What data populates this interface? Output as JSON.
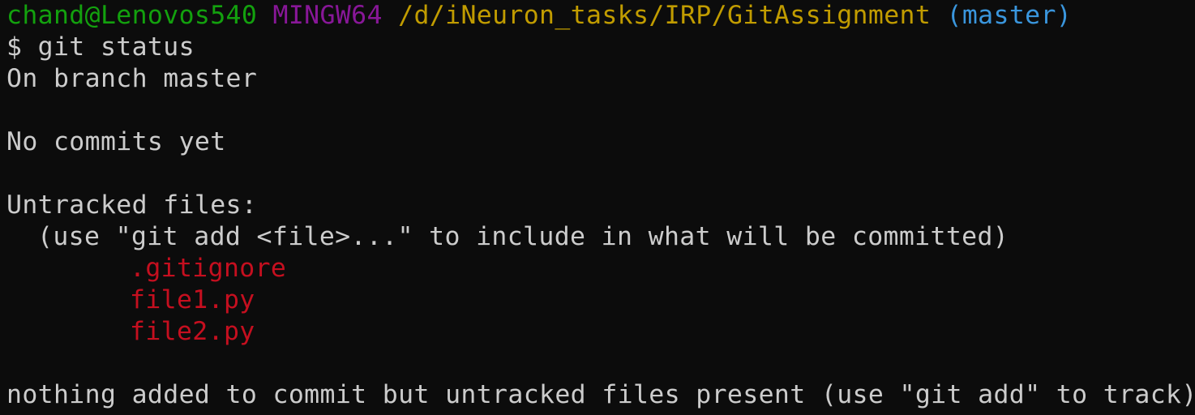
{
  "colors": {
    "background": "#0c0c0c",
    "foreground": "#cccccc",
    "user_host": "#13a10e",
    "msystem": "#881798",
    "path": "#c19c00",
    "branch": "#3a96dd",
    "untracked": "#c50f1f"
  },
  "prompt": {
    "user_host": "chand@Lenovos540",
    "msystem": "MINGW64",
    "path": "/d/iNeuron_tasks/IRP/GitAssignment",
    "branch": "(master)"
  },
  "command_line": "$ git status",
  "output": {
    "branch_line": "On branch master",
    "commits_line": "No commits yet",
    "untracked_header": "Untracked files:",
    "untracked_hint": "(use \"git add <file>...\" to include in what will be committed)",
    "untracked_files": [
      ".gitignore",
      "file1.py",
      "file2.py"
    ],
    "summary_line": "nothing added to commit but untracked files present (use \"git add\" to track)"
  }
}
